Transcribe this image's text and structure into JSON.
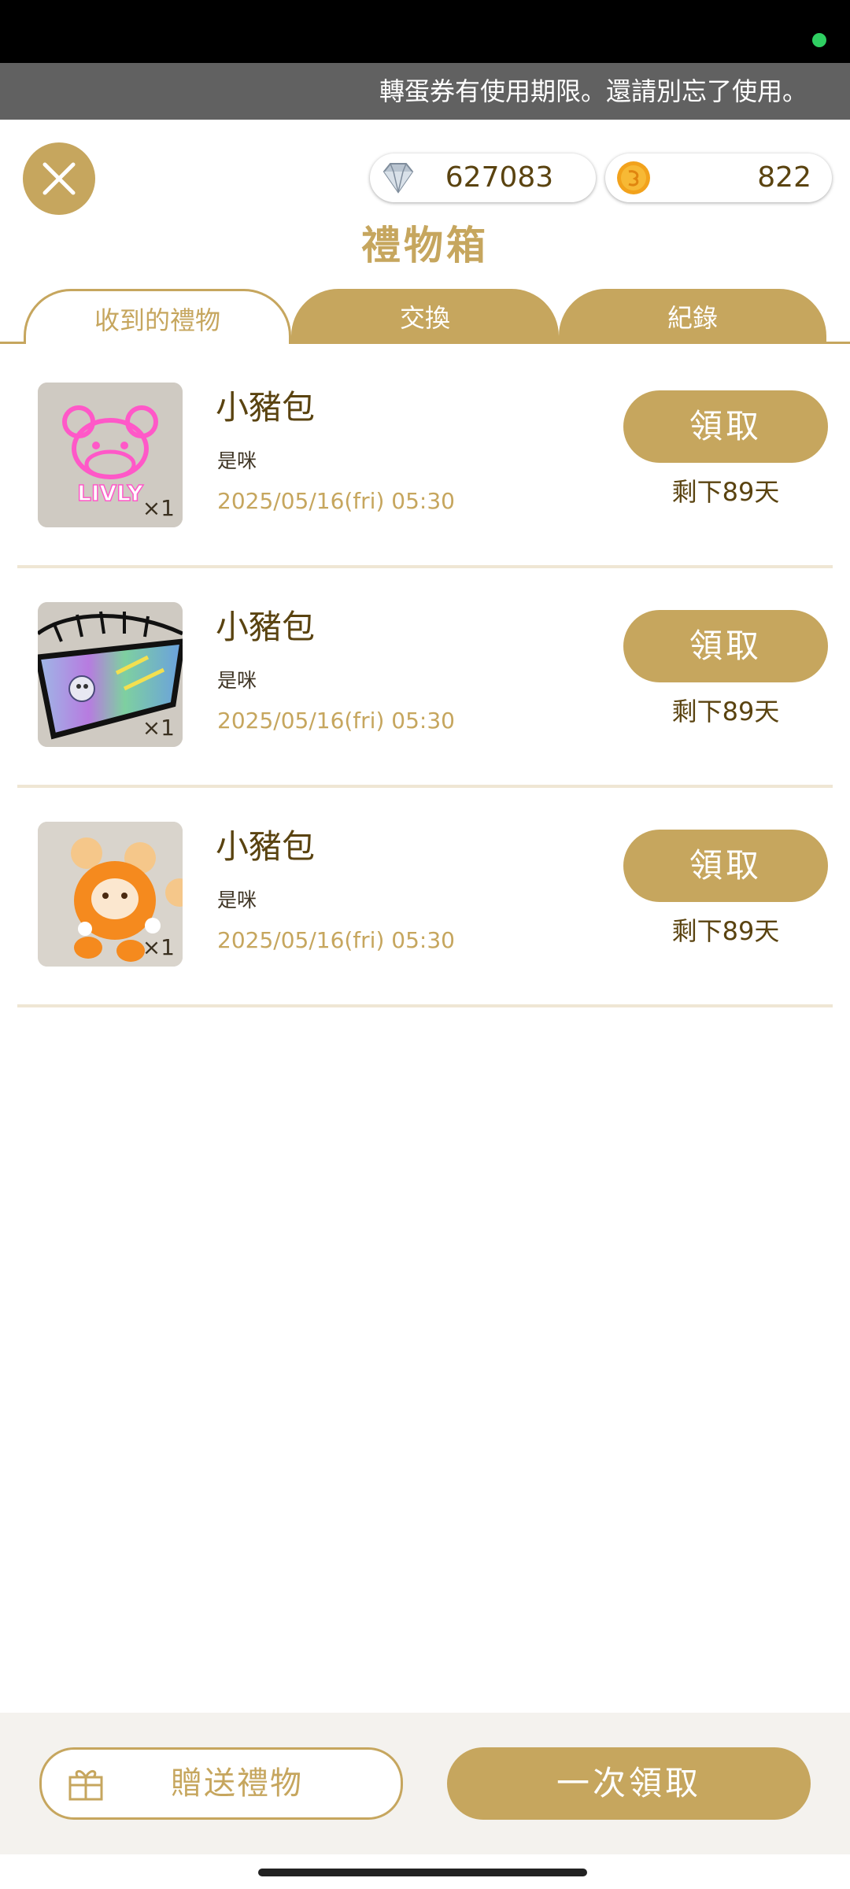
{
  "notice": "轉蛋券有使用期限。還請別忘了使用。",
  "currency": {
    "gems": "627083",
    "gems_icon": "diamond-icon",
    "coins": "822",
    "coins_icon": "coin-icon"
  },
  "page_title": "禮物箱",
  "tabs": [
    {
      "label": "收到的禮物",
      "active": true
    },
    {
      "label": "交換",
      "active": false
    },
    {
      "label": "紀錄",
      "active": false
    }
  ],
  "gifts": [
    {
      "name": "小豬包",
      "sender": "是咪",
      "date": "2025/05/16(fri) 05:30",
      "qty": "×1",
      "claim_label": "領取",
      "remaining": "剩下89天",
      "thumb_text": "LIVLY",
      "thumb": "pink-neon-bear-sign"
    },
    {
      "name": "小豬包",
      "sender": "是咪",
      "date": "2025/05/16(fri) 05:30",
      "qty": "×1",
      "claim_label": "領取",
      "remaining": "剩下89天",
      "thumb": "holographic-banner"
    },
    {
      "name": "小豬包",
      "sender": "是咪",
      "date": "2025/05/16(fri) 05:30",
      "qty": "×1",
      "claim_label": "領取",
      "remaining": "剩下89天",
      "thumb": "orange-fluffy-creature"
    }
  ],
  "bottom": {
    "send_label": "贈送禮物",
    "send_icon": "gift-icon",
    "claim_all_label": "一次領取"
  },
  "colors": {
    "accent": "#c6a65e",
    "text_brown": "#5a4310",
    "status_green": "#2fcf62"
  }
}
